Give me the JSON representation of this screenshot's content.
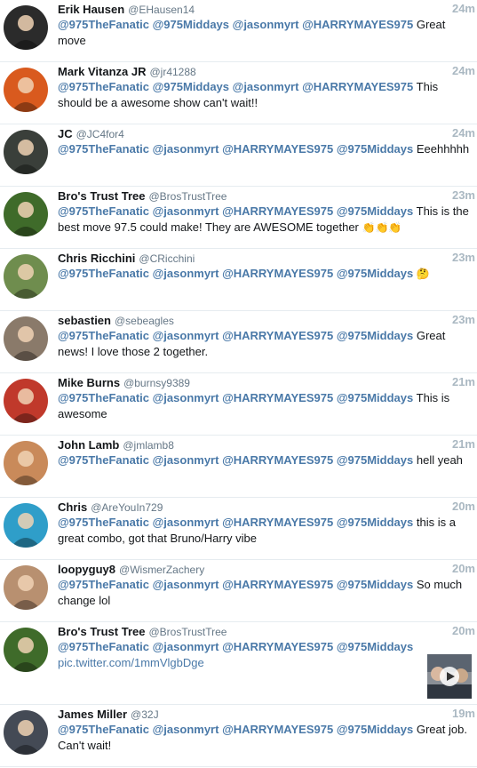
{
  "tweets": [
    {
      "name": "Erik Hausen",
      "handle": "@EHausen14",
      "time": "24m",
      "m": [
        "@975TheFanatic",
        "@975Middays",
        "@jasonmyrt",
        "@HARRYMAYES975"
      ],
      "text": "Great move",
      "avatar_color": "#2b2b2b"
    },
    {
      "name": "Mark Vitanza JR",
      "handle": "@jr41288",
      "time": "24m",
      "m": [
        "@975TheFanatic",
        "@975Middays",
        "@jasonmyrt",
        "@HARRYMAYES975"
      ],
      "text": "This should be a awesome show can't wait!!",
      "avatar_color": "#d95a1e"
    },
    {
      "name": "JC",
      "handle": "@JC4for4",
      "time": "24m",
      "m": [
        "@975TheFanatic",
        "@jasonmyrt",
        "@HARRYMAYES975",
        "@975Middays"
      ],
      "text": "Eeehhhhh",
      "avatar_color": "#3a3f3a"
    },
    {
      "name": "Bro's Trust Tree",
      "handle": "@BrosTrustTree",
      "time": "23m",
      "m": [
        "@975TheFanatic",
        "@jasonmyrt",
        "@HARRYMAYES975",
        "@975Middays"
      ],
      "text": "This is the best move 97.5 could make! They are AWESOME together",
      "emoji": "👏👏👏",
      "avatar_color": "#3f6b2a"
    },
    {
      "name": "Chris Ricchini",
      "handle": "@CRicchini",
      "time": "23m",
      "m": [
        "@975TheFanatic",
        "@jasonmyrt",
        "@HARRYMAYES975",
        "@975Middays"
      ],
      "text": "",
      "emoji": "🤔",
      "avatar_color": "#6f8d4e"
    },
    {
      "name": "sebastien",
      "handle": "@sebeagles",
      "time": "23m",
      "m": [
        "@975TheFanatic",
        "@jasonmyrt",
        "@HARRYMAYES975",
        "@975Middays"
      ],
      "text": "Great news! I love those 2 together.",
      "avatar_color": "#8a7a6a"
    },
    {
      "name": "Mike Burns",
      "handle": "@burnsy9389",
      "time": "21m",
      "m": [
        "@975TheFanatic",
        "@jasonmyrt",
        "@HARRYMAYES975",
        "@975Middays"
      ],
      "text": "This is awesome",
      "avatar_color": "#c0392b"
    },
    {
      "name": "John Lamb",
      "handle": "@jmlamb8",
      "time": "21m",
      "m": [
        "@975TheFanatic",
        "@jasonmyrt",
        "@HARRYMAYES975",
        "@975Middays"
      ],
      "text": "hell yeah",
      "avatar_color": "#c98a5a"
    },
    {
      "name": "Chris",
      "handle": "@AreYouIn729",
      "time": "20m",
      "m": [
        "@975TheFanatic",
        "@jasonmyrt",
        "@HARRYMAYES975",
        "@975Middays"
      ],
      "text": "this is a great combo, got that Bruno/Harry vibe",
      "avatar_color": "#2f9ec9"
    },
    {
      "name": "loopyguy8",
      "handle": "@WismerZachery",
      "time": "20m",
      "m": [
        "@975TheFanatic",
        "@jasonmyrt",
        "@HARRYMAYES975",
        "@975Middays"
      ],
      "text": "So much change lol",
      "avatar_color": "#b89070"
    },
    {
      "name": "Bro's Trust Tree",
      "handle": "@BrosTrustTree",
      "time": "20m",
      "m": [
        "@975TheFanatic",
        "@jasonmyrt",
        "@HARRYMAYES975",
        "@975Middays"
      ],
      "text": "",
      "link": "pic.twitter.com/1mmVlgbDge",
      "avatar_color": "#3f6b2a",
      "has_media": true
    },
    {
      "name": "James Miller",
      "handle": "@32J",
      "time": "19m",
      "m": [
        "@975TheFanatic",
        "@jasonmyrt",
        "@HARRYMAYES975",
        "@975Middays"
      ],
      "text": "Great job.  Can't wait!",
      "avatar_color": "#444a55"
    }
  ],
  "colors": {
    "mention": "#4a79a8",
    "time": "#aab8c2",
    "divider": "#e6ecf0"
  }
}
